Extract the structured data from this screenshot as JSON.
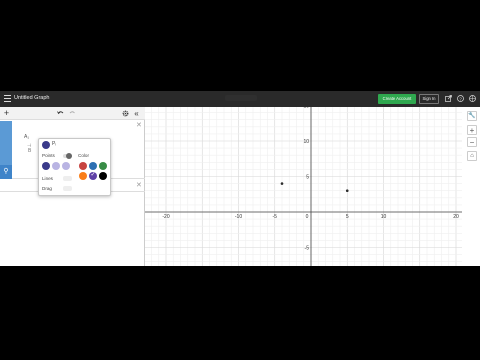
{
  "topbar": {
    "title": "Untitled Graph",
    "create_account_label": "Create Account",
    "sign_in_label": "Sign In",
    "accent_color": "#2fa84f"
  },
  "panel": {
    "add_icon": "plus-icon",
    "undo_icon": "undo-icon",
    "settings_icon": "gear-icon",
    "collapse_icon": "double-chevron-left-icon",
    "expr1_label": "A₁",
    "expr1_sub": "B",
    "expr1_dash": "⊣"
  },
  "popup": {
    "points_label": "Points",
    "color_label": "Color",
    "lines_label": "Lines",
    "drag_label": "Drag",
    "colors": [
      "#c74440",
      "#2d70b3",
      "#388c46",
      "#fa7e19",
      "#6042a6",
      "#000000"
    ],
    "selected_color": "#6042a6"
  },
  "graph": {
    "x_ticks": [
      "-20",
      "-10",
      "-5",
      "0",
      "5",
      "10",
      "20"
    ],
    "y_ticks": [
      "15",
      "10",
      "5",
      "-5",
      "-10"
    ],
    "points": [
      {
        "x": -4,
        "y": 4
      },
      {
        "x": 5,
        "y": 3
      }
    ]
  },
  "right_tools": {
    "wrench_icon": "wrench-icon",
    "zoom_in_icon": "plus-icon",
    "zoom_out_icon": "minus-icon",
    "home_icon": "home-icon"
  }
}
